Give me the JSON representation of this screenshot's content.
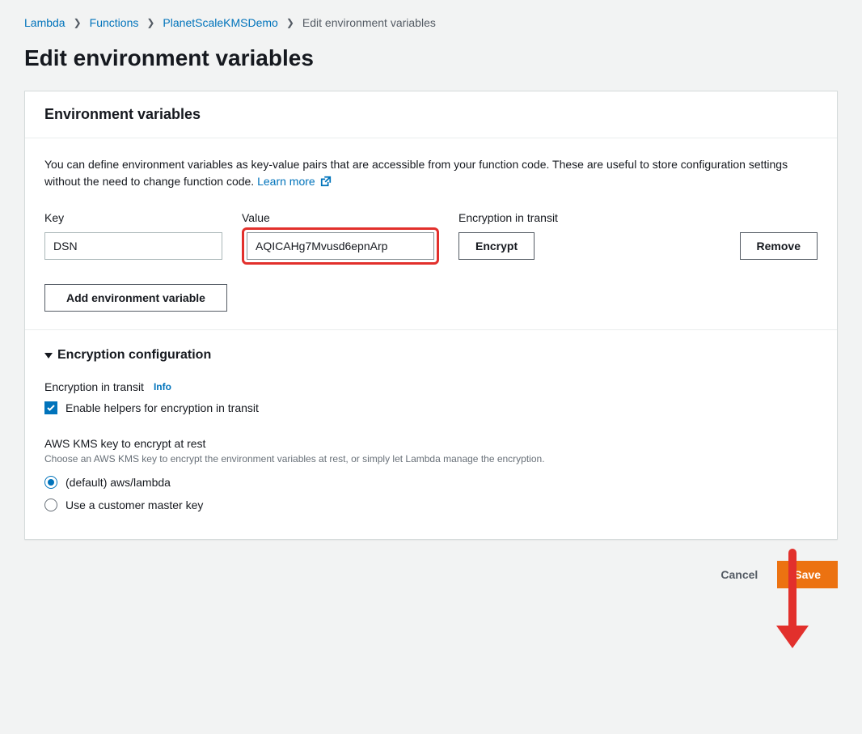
{
  "breadcrumb": {
    "items": [
      {
        "label": "Lambda",
        "link": true
      },
      {
        "label": "Functions",
        "link": true
      },
      {
        "label": "PlanetScaleKMSDemo",
        "link": true
      },
      {
        "label": "Edit environment variables",
        "link": false
      }
    ]
  },
  "page": {
    "title": "Edit environment variables"
  },
  "env_panel": {
    "header": "Environment variables",
    "description": "You can define environment variables as key-value pairs that are accessible from your function code. These are useful to store configuration settings without the need to change function code. ",
    "learn_more": "Learn more",
    "columns": {
      "key": "Key",
      "value": "Value",
      "transit": "Encryption in transit"
    },
    "row": {
      "key": "DSN",
      "value": "AQICAHg7Mvusd6epnArp",
      "encrypt_label": "Encrypt",
      "remove_label": "Remove"
    },
    "add_label": "Add environment variable"
  },
  "encryption": {
    "section_title": "Encryption configuration",
    "transit_heading": "Encryption in transit",
    "info_label": "Info",
    "enable_helpers_label": "Enable helpers for encryption in transit",
    "enable_helpers_checked": true,
    "kms_heading": "AWS KMS key to encrypt at rest",
    "kms_sub": "Choose an AWS KMS key to encrypt the environment variables at rest, or simply let Lambda manage the encryption.",
    "options": [
      {
        "label": "(default) aws/lambda",
        "selected": true
      },
      {
        "label": "Use a customer master key",
        "selected": false
      }
    ]
  },
  "footer": {
    "cancel": "Cancel",
    "save": "Save"
  }
}
